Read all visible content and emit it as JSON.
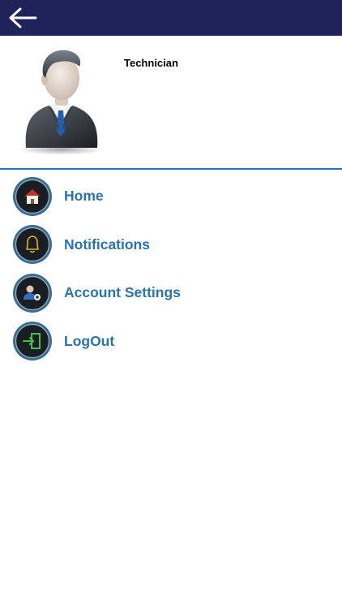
{
  "header": {
    "back_icon": "arrow-left-icon"
  },
  "profile": {
    "role": "Technician",
    "avatar_icon": "businessman-avatar"
  },
  "menu": {
    "items": [
      {
        "label": "Home",
        "icon": "home-icon"
      },
      {
        "label": "Notifications",
        "icon": "bell-icon"
      },
      {
        "label": "Account Settings",
        "icon": "user-settings-icon"
      },
      {
        "label": "LogOut",
        "icon": "logout-icon"
      }
    ]
  },
  "colors": {
    "header_bg": "#1f2358",
    "accent": "#2a72b0",
    "divider": "#2e6fa6"
  }
}
